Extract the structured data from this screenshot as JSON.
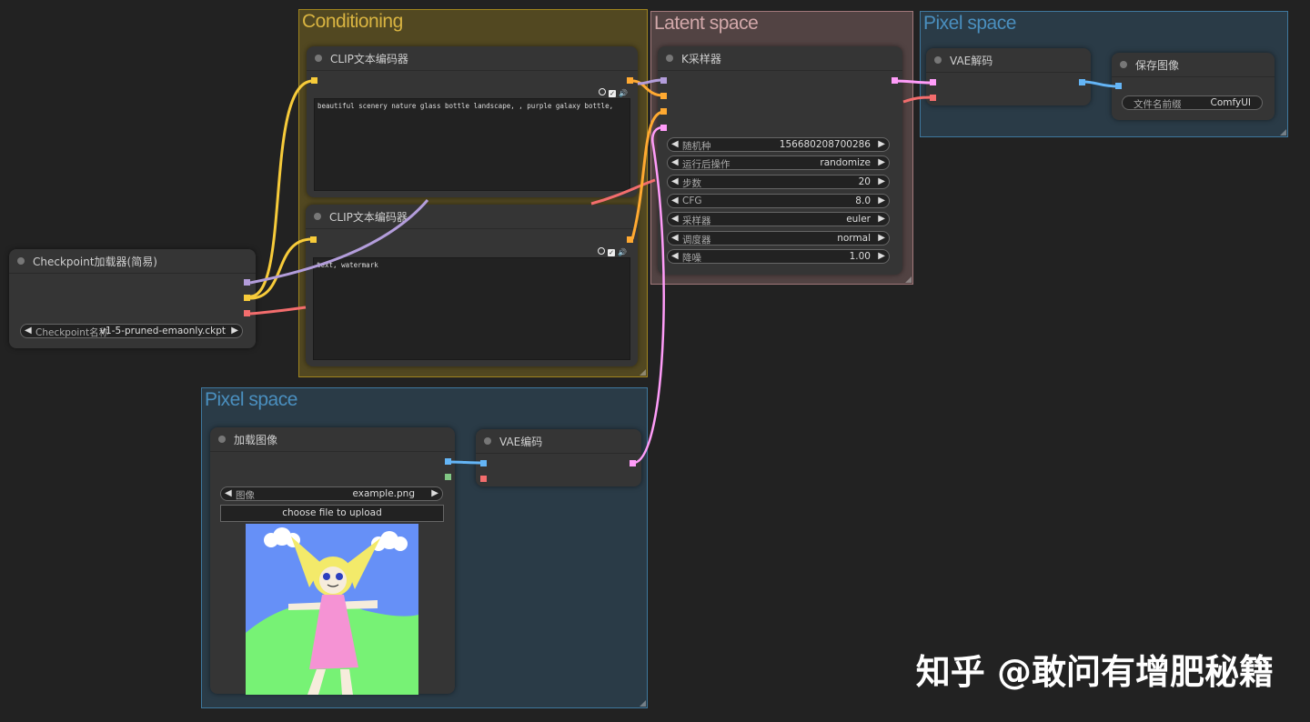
{
  "groups": {
    "conditioning": {
      "title": "Conditioning",
      "color": "#a1851f"
    },
    "latent": {
      "title": "Latent space",
      "color": "#a1787a"
    },
    "pixel_top": {
      "title": "Pixel space",
      "color": "#3f789e"
    },
    "pixel_bottom": {
      "title": "Pixel space",
      "color": "#3f789e"
    }
  },
  "nodes": {
    "clip_pos": {
      "title": "CLIP文本编码器",
      "text": "beautiful scenery nature glass bottle landscape, , purple galaxy bottle,"
    },
    "clip_neg": {
      "title": "CLIP文本编码器",
      "text": "text, watermark"
    },
    "ksampler": {
      "title": "K采样器",
      "widgets": [
        {
          "label": "随机种",
          "value": "156680208700286"
        },
        {
          "label": "运行后操作",
          "value": "randomize"
        },
        {
          "label": "步数",
          "value": "20"
        },
        {
          "label": "CFG",
          "value": "8.0"
        },
        {
          "label": "采样器",
          "value": "euler"
        },
        {
          "label": "调度器",
          "value": "normal"
        },
        {
          "label": "降噪",
          "value": "1.00"
        }
      ]
    },
    "checkpoint": {
      "title": "Checkpoint加载器(简易)",
      "widget": {
        "label": "Checkpoint名称",
        "value": "v1-5-pruned-emaonly.ckpt"
      }
    },
    "vae_decode": {
      "title": "VAE解码"
    },
    "save_image": {
      "title": "保存图像",
      "widget": {
        "label": "文件名前缀",
        "value": "ComfyUI"
      }
    },
    "load_image": {
      "title": "加载图像",
      "widget": {
        "label": "图像",
        "value": "example.png"
      },
      "upload_label": "choose file to upload"
    },
    "vae_encode": {
      "title": "VAE编码"
    }
  },
  "icons": {
    "arrow_left": "◀",
    "arrow_right": "▶",
    "check": "✓",
    "speaker": "🔊"
  },
  "watermark": "知乎 @敢问有增肥秘籍",
  "socket_colors": {
    "model": "#b39ddb",
    "clip": "#f7cb3a",
    "vae": "#f36d6d",
    "conditioning": "#ffa931",
    "latent": "#ff9cf9",
    "image": "#64b5f6",
    "mask": "#81c784"
  }
}
